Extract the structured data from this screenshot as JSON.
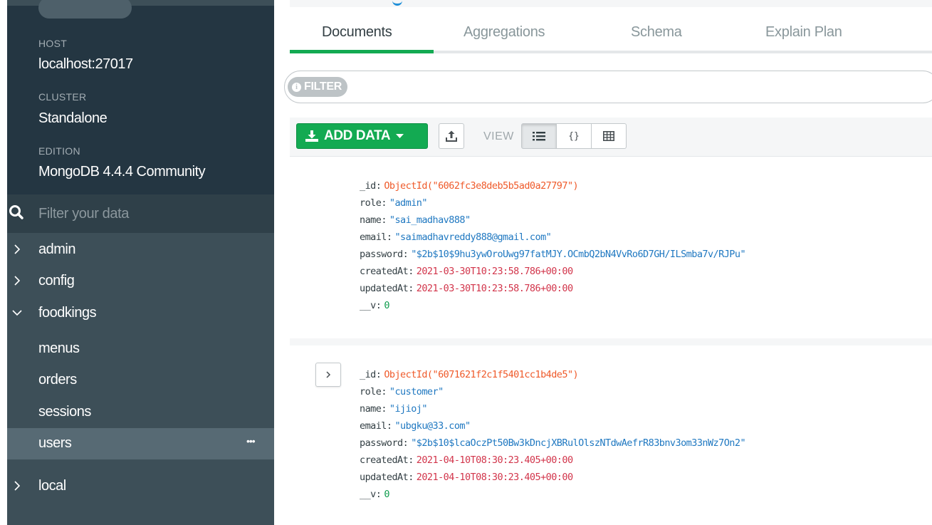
{
  "sidebar": {
    "host_label": "HOST",
    "host_value": "localhost:27017",
    "cluster_label": "CLUSTER",
    "cluster_value": "Standalone",
    "edition_label": "EDITION",
    "edition_value": "MongoDB 4.4.4 Community",
    "filter_placeholder": "Filter your data",
    "databases": [
      {
        "name": "admin",
        "icon": "chevron-right-icon"
      },
      {
        "name": "config",
        "icon": "chevron-right-icon"
      },
      {
        "name": "foodkings",
        "icon": "chevron-down-icon"
      }
    ],
    "collections": [
      "menus",
      "orders",
      "sessions",
      "users"
    ],
    "active_collection_menu": "•••",
    "last_database": {
      "name": "local",
      "icon": "chevron-right-icon"
    }
  },
  "tabs": [
    "Documents",
    "Aggregations",
    "Schema",
    "Explain Plan"
  ],
  "filter": {
    "badge_label": "FILTER"
  },
  "toolbar": {
    "add_data_label": "ADD DATA",
    "view_label": "VIEW",
    "view_modes": [
      "list-view-icon",
      "json-view-icon",
      "table-view-icon"
    ],
    "json_glyph": "{}"
  },
  "documents": [
    {
      "fields": [
        {
          "key": "_id",
          "value": "ObjectId(\"6062fc3e8deb5b5ad0a27797\")",
          "type": "oid"
        },
        {
          "key": "role",
          "value": "\"admin\"",
          "type": "str"
        },
        {
          "key": "name",
          "value": "\"sai_madhav888\"",
          "type": "str"
        },
        {
          "key": "email",
          "value": "\"saimadhavreddy888@gmail.com\"",
          "type": "str"
        },
        {
          "key": "password",
          "value": "\"$2b$10$9hu3ywOroUwg97fatMJY.OCmbQ2bN4VvRo6D7GH/ILSmba7v/RJPu\"",
          "type": "str"
        },
        {
          "key": "createdAt",
          "value": "2021-03-30T10:23:58.786+00:00",
          "type": "date"
        },
        {
          "key": "updatedAt",
          "value": "2021-03-30T10:23:58.786+00:00",
          "type": "date"
        },
        {
          "key": "__v",
          "value": "0",
          "type": "num"
        }
      ]
    },
    {
      "fields": [
        {
          "key": "_id",
          "value": "ObjectId(\"6071621f2c1f5401cc1b4de5\")",
          "type": "oid"
        },
        {
          "key": "role",
          "value": "\"customer\"",
          "type": "str"
        },
        {
          "key": "name",
          "value": "\"ijioj\"",
          "type": "str"
        },
        {
          "key": "email",
          "value": "\"ubgku@33.com\"",
          "type": "str"
        },
        {
          "key": "password",
          "value": "\"$2b$10$lcaOczPt50Bw3kDncjXBRulOlszNTdwAefrR83bnv3om33nWz7On2\"",
          "type": "str"
        },
        {
          "key": "createdAt",
          "value": "2021-04-10T08:30:23.405+00:00",
          "type": "date"
        },
        {
          "key": "updatedAt",
          "value": "2021-04-10T08:30:23.405+00:00",
          "type": "date"
        },
        {
          "key": "__v",
          "value": "0",
          "type": "num"
        }
      ]
    }
  ],
  "colors": {
    "sidebar_bg": "#3d4f58",
    "sidebar_info_bg": "#243642",
    "accent_green": "#13aa52",
    "oid": "#ef5a2a",
    "string": "#1f78c1",
    "date": "#d2354b",
    "number": "#109d4e"
  }
}
